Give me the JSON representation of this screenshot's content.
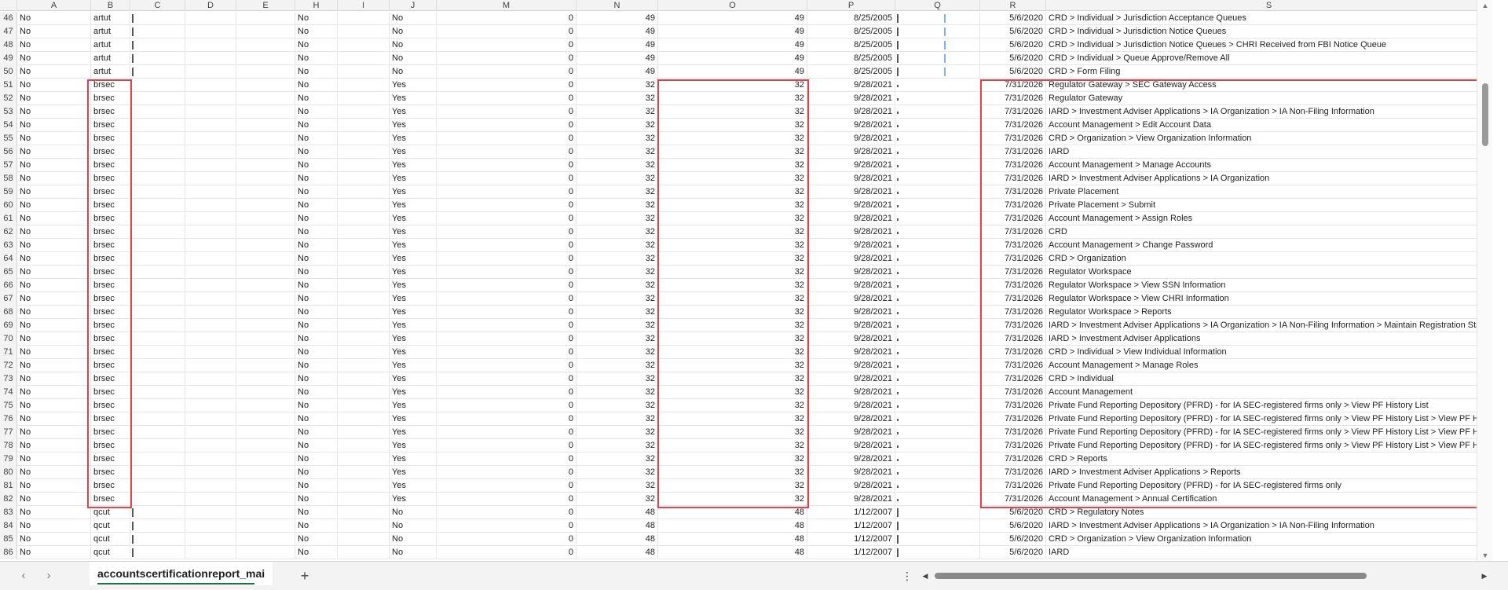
{
  "columns": [
    "A",
    "B",
    "C",
    "D",
    "E",
    "H",
    "I",
    "J",
    "M",
    "N",
    "O",
    "P",
    "Q",
    "R",
    "S"
  ],
  "rows": [
    {
      "num": "46",
      "a": "No",
      "b": "artut",
      "h": "No",
      "j": "No",
      "m": "0",
      "n": "49",
      "o": "49",
      "p": "8/25/2005",
      "r": "5/6/2020",
      "s": "CRD > Individual > Jurisdiction Acceptance Queues"
    },
    {
      "num": "47",
      "a": "No",
      "b": "artut",
      "h": "No",
      "j": "No",
      "m": "0",
      "n": "49",
      "o": "49",
      "p": "8/25/2005",
      "r": "5/6/2020",
      "s": "CRD > Individual > Jurisdiction Notice Queues"
    },
    {
      "num": "48",
      "a": "No",
      "b": "artut",
      "h": "No",
      "j": "No",
      "m": "0",
      "n": "49",
      "o": "49",
      "p": "8/25/2005",
      "r": "5/6/2020",
      "s": "CRD > Individual > Jurisdiction Notice Queues > CHRI Received from FBI Notice Queue"
    },
    {
      "num": "49",
      "a": "No",
      "b": "artut",
      "h": "No",
      "j": "No",
      "m": "0",
      "n": "49",
      "o": "49",
      "p": "8/25/2005",
      "r": "5/6/2020",
      "s": "CRD > Individual > Queue Approve/Remove All"
    },
    {
      "num": "50",
      "a": "No",
      "b": "artut",
      "h": "No",
      "j": "No",
      "m": "0",
      "n": "49",
      "o": "49",
      "p": "8/25/2005",
      "r": "5/6/2020",
      "s": "CRD > Form Filing"
    },
    {
      "num": "51",
      "a": "No",
      "b": "brsec",
      "h": "No",
      "j": "Yes",
      "m": "0",
      "n": "32",
      "o": "32",
      "p": "9/28/2021",
      "r": "7/31/2026",
      "s": "Regulator Gateway > SEC Gateway Access"
    },
    {
      "num": "52",
      "a": "No",
      "b": "brsec",
      "h": "No",
      "j": "Yes",
      "m": "0",
      "n": "32",
      "o": "32",
      "p": "9/28/2021",
      "r": "7/31/2026",
      "s": "Regulator Gateway"
    },
    {
      "num": "53",
      "a": "No",
      "b": "brsec",
      "h": "No",
      "j": "Yes",
      "m": "0",
      "n": "32",
      "o": "32",
      "p": "9/28/2021",
      "r": "7/31/2026",
      "s": "IARD > Investment Adviser Applications > IA Organization > IA Non-Filing Information"
    },
    {
      "num": "54",
      "a": "No",
      "b": "brsec",
      "h": "No",
      "j": "Yes",
      "m": "0",
      "n": "32",
      "o": "32",
      "p": "9/28/2021",
      "r": "7/31/2026",
      "s": "Account Management > Edit Account Data"
    },
    {
      "num": "55",
      "a": "No",
      "b": "brsec",
      "h": "No",
      "j": "Yes",
      "m": "0",
      "n": "32",
      "o": "32",
      "p": "9/28/2021",
      "r": "7/31/2026",
      "s": "CRD > Organization > View Organization Information"
    },
    {
      "num": "56",
      "a": "No",
      "b": "brsec",
      "h": "No",
      "j": "Yes",
      "m": "0",
      "n": "32",
      "o": "32",
      "p": "9/28/2021",
      "r": "7/31/2026",
      "s": "IARD"
    },
    {
      "num": "57",
      "a": "No",
      "b": "brsec",
      "h": "No",
      "j": "Yes",
      "m": "0",
      "n": "32",
      "o": "32",
      "p": "9/28/2021",
      "r": "7/31/2026",
      "s": "Account Management > Manage Accounts"
    },
    {
      "num": "58",
      "a": "No",
      "b": "brsec",
      "h": "No",
      "j": "Yes",
      "m": "0",
      "n": "32",
      "o": "32",
      "p": "9/28/2021",
      "r": "7/31/2026",
      "s": "IARD > Investment Adviser Applications > IA Organization"
    },
    {
      "num": "59",
      "a": "No",
      "b": "brsec",
      "h": "No",
      "j": "Yes",
      "m": "0",
      "n": "32",
      "o": "32",
      "p": "9/28/2021",
      "r": "7/31/2026",
      "s": "Private Placement"
    },
    {
      "num": "60",
      "a": "No",
      "b": "brsec",
      "h": "No",
      "j": "Yes",
      "m": "0",
      "n": "32",
      "o": "32",
      "p": "9/28/2021",
      "r": "7/31/2026",
      "s": "Private Placement > Submit"
    },
    {
      "num": "61",
      "a": "No",
      "b": "brsec",
      "h": "No",
      "j": "Yes",
      "m": "0",
      "n": "32",
      "o": "32",
      "p": "9/28/2021",
      "r": "7/31/2026",
      "s": "Account Management > Assign Roles"
    },
    {
      "num": "62",
      "a": "No",
      "b": "brsec",
      "h": "No",
      "j": "Yes",
      "m": "0",
      "n": "32",
      "o": "32",
      "p": "9/28/2021",
      "r": "7/31/2026",
      "s": "CRD"
    },
    {
      "num": "63",
      "a": "No",
      "b": "brsec",
      "h": "No",
      "j": "Yes",
      "m": "0",
      "n": "32",
      "o": "32",
      "p": "9/28/2021",
      "r": "7/31/2026",
      "s": "Account Management > Change Password"
    },
    {
      "num": "64",
      "a": "No",
      "b": "brsec",
      "h": "No",
      "j": "Yes",
      "m": "0",
      "n": "32",
      "o": "32",
      "p": "9/28/2021",
      "r": "7/31/2026",
      "s": "CRD > Organization"
    },
    {
      "num": "65",
      "a": "No",
      "b": "brsec",
      "h": "No",
      "j": "Yes",
      "m": "0",
      "n": "32",
      "o": "32",
      "p": "9/28/2021",
      "r": "7/31/2026",
      "s": "Regulator Workspace"
    },
    {
      "num": "66",
      "a": "No",
      "b": "brsec",
      "h": "No",
      "j": "Yes",
      "m": "0",
      "n": "32",
      "o": "32",
      "p": "9/28/2021",
      "r": "7/31/2026",
      "s": "Regulator Workspace > View SSN Information"
    },
    {
      "num": "67",
      "a": "No",
      "b": "brsec",
      "h": "No",
      "j": "Yes",
      "m": "0",
      "n": "32",
      "o": "32",
      "p": "9/28/2021",
      "r": "7/31/2026",
      "s": "Regulator Workspace > View CHRI Information"
    },
    {
      "num": "68",
      "a": "No",
      "b": "brsec",
      "h": "No",
      "j": "Yes",
      "m": "0",
      "n": "32",
      "o": "32",
      "p": "9/28/2021",
      "r": "7/31/2026",
      "s": "Regulator Workspace > Reports"
    },
    {
      "num": "69",
      "a": "No",
      "b": "brsec",
      "h": "No",
      "j": "Yes",
      "m": "0",
      "n": "32",
      "o": "32",
      "p": "9/28/2021",
      "r": "7/31/2026",
      "s": "IARD > Investment Adviser Applications > IA Organization > IA Non-Filing Information > Maintain Registration Status"
    },
    {
      "num": "70",
      "a": "No",
      "b": "brsec",
      "h": "No",
      "j": "Yes",
      "m": "0",
      "n": "32",
      "o": "32",
      "p": "9/28/2021",
      "r": "7/31/2026",
      "s": "IARD > Investment Adviser Applications"
    },
    {
      "num": "71",
      "a": "No",
      "b": "brsec",
      "h": "No",
      "j": "Yes",
      "m": "0",
      "n": "32",
      "o": "32",
      "p": "9/28/2021",
      "r": "7/31/2026",
      "s": "CRD > Individual > View Individual Information"
    },
    {
      "num": "72",
      "a": "No",
      "b": "brsec",
      "h": "No",
      "j": "Yes",
      "m": "0",
      "n": "32",
      "o": "32",
      "p": "9/28/2021",
      "r": "7/31/2026",
      "s": "Account Management > Manage Roles"
    },
    {
      "num": "73",
      "a": "No",
      "b": "brsec",
      "h": "No",
      "j": "Yes",
      "m": "0",
      "n": "32",
      "o": "32",
      "p": "9/28/2021",
      "r": "7/31/2026",
      "s": "CRD > Individual"
    },
    {
      "num": "74",
      "a": "No",
      "b": "brsec",
      "h": "No",
      "j": "Yes",
      "m": "0",
      "n": "32",
      "o": "32",
      "p": "9/28/2021",
      "r": "7/31/2026",
      "s": "Account Management"
    },
    {
      "num": "75",
      "a": "No",
      "b": "brsec",
      "h": "No",
      "j": "Yes",
      "m": "0",
      "n": "32",
      "o": "32",
      "p": "9/28/2021",
      "r": "7/31/2026",
      "s": "Private Fund Reporting Depository (PFRD) - for IA SEC-registered firms only > View PF History List"
    },
    {
      "num": "76",
      "a": "No",
      "b": "brsec",
      "h": "No",
      "j": "Yes",
      "m": "0",
      "n": "32",
      "o": "32",
      "p": "9/28/2021",
      "r": "7/31/2026",
      "s": "Private Fund Reporting Depository (PFRD) - for IA SEC-registered firms only > View PF History List > View PF History - A"
    },
    {
      "num": "77",
      "a": "No",
      "b": "brsec",
      "h": "No",
      "j": "Yes",
      "m": "0",
      "n": "32",
      "o": "32",
      "p": "9/28/2021",
      "r": "7/31/2026",
      "s": "Private Fund Reporting Depository (PFRD) - for IA SEC-registered firms only > View PF History List > View PF History - A"
    },
    {
      "num": "78",
      "a": "No",
      "b": "brsec",
      "h": "No",
      "j": "Yes",
      "m": "0",
      "n": "32",
      "o": "32",
      "p": "9/28/2021",
      "r": "7/31/2026",
      "s": "Private Fund Reporting Depository (PFRD) - for IA SEC-registered firms only > View PF History List > View PF History - A"
    },
    {
      "num": "79",
      "a": "No",
      "b": "brsec",
      "h": "No",
      "j": "Yes",
      "m": "0",
      "n": "32",
      "o": "32",
      "p": "9/28/2021",
      "r": "7/31/2026",
      "s": "CRD > Reports"
    },
    {
      "num": "80",
      "a": "No",
      "b": "brsec",
      "h": "No",
      "j": "Yes",
      "m": "0",
      "n": "32",
      "o": "32",
      "p": "9/28/2021",
      "r": "7/31/2026",
      "s": "IARD > Investment Adviser Applications > Reports"
    },
    {
      "num": "81",
      "a": "No",
      "b": "brsec",
      "h": "No",
      "j": "Yes",
      "m": "0",
      "n": "32",
      "o": "32",
      "p": "9/28/2021",
      "r": "7/31/2026",
      "s": "Private Fund Reporting Depository (PFRD) - for IA SEC-registered firms only"
    },
    {
      "num": "82",
      "a": "No",
      "b": "brsec",
      "h": "No",
      "j": "Yes",
      "m": "0",
      "n": "32",
      "o": "32",
      "p": "9/28/2021",
      "r": "7/31/2026",
      "s": "Account Management > Annual Certification"
    },
    {
      "num": "83",
      "a": "No",
      "b": "qcut",
      "h": "No",
      "j": "No",
      "m": "0",
      "n": "48",
      "o": "48",
      "p": "1/12/2007",
      "r": "5/6/2020",
      "s": "CRD > Regulatory Notes"
    },
    {
      "num": "84",
      "a": "No",
      "b": "qcut",
      "h": "No",
      "j": "No",
      "m": "0",
      "n": "48",
      "o": "48",
      "p": "1/12/2007",
      "r": "5/6/2020",
      "s": "IARD > Investment Adviser Applications > IA Organization > IA Non-Filing Information"
    },
    {
      "num": "85",
      "a": "No",
      "b": "qcut",
      "h": "No",
      "j": "No",
      "m": "0",
      "n": "48",
      "o": "48",
      "p": "1/12/2007",
      "r": "5/6/2020",
      "s": "CRD > Organization > View Organization Information"
    },
    {
      "num": "86",
      "a": "No",
      "b": "qcut",
      "h": "No",
      "j": "No",
      "m": "0",
      "n": "48",
      "o": "48",
      "p": "1/12/2007",
      "r": "5/6/2020",
      "s": "IARD"
    }
  ],
  "sheet_tab": "accountscertificationreport_mai",
  "add_sheet_label": "+",
  "nav_prev": "‹",
  "nav_next": "›",
  "more_dots": "⋮",
  "scroll_up": "▲",
  "scroll_down": "▼",
  "scroll_left": "◀",
  "scroll_right": "▶",
  "colors": {
    "highlight": "#e0434b",
    "tab_accent": "#1e7145"
  }
}
